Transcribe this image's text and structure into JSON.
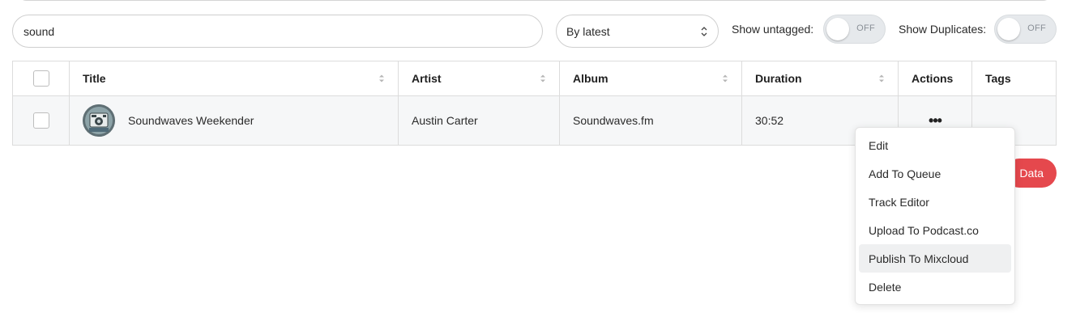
{
  "search": {
    "value": "sound"
  },
  "sort_select": {
    "selected": "By latest"
  },
  "toggles": {
    "untagged": {
      "label": "Show untagged:",
      "state": "OFF"
    },
    "duplicates": {
      "label": "Show Duplicates:",
      "state": "OFF"
    }
  },
  "table": {
    "columns": [
      "Title",
      "Artist",
      "Album",
      "Duration",
      "Actions",
      "Tags"
    ],
    "rows": [
      {
        "title": "Soundwaves Weekender",
        "artist": "Austin Carter",
        "album": "Soundwaves.fm",
        "duration": "30:52",
        "actions_icon": "ellipsis-icon",
        "tags": ""
      }
    ]
  },
  "partial_button": {
    "label": "Data"
  },
  "actions_menu": {
    "items": [
      "Edit",
      "Add To Queue",
      "Track Editor",
      "Upload To Podcast.co",
      "Publish To Mixcloud",
      "Delete"
    ],
    "highlighted": "Publish To Mixcloud"
  },
  "colors": {
    "accent_red": "#e5484d",
    "toggle_bg": "#e6e9ec",
    "row_bg": "#f6f7f8"
  }
}
